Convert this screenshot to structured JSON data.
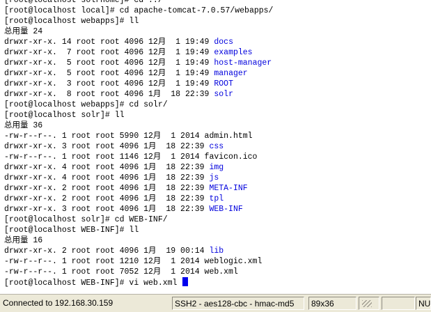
{
  "terminal": {
    "lines": [
      [
        {
          "t": "[root@localhost solrhome]# cd ../"
        }
      ],
      [
        {
          "t": "[root@localhost local]# cd apache-tomcat-7.0.57/webapps/"
        }
      ],
      [
        {
          "t": "[root@localhost webapps]# ll"
        }
      ],
      [
        {
          "t": "总用量 24"
        }
      ],
      [
        {
          "t": "drwxr-xr-x. 14 root root 4096 12月  1 19:49 "
        },
        {
          "t": "docs",
          "c": "dir"
        }
      ],
      [
        {
          "t": "drwxr-xr-x.  7 root root 4096 12月  1 19:49 "
        },
        {
          "t": "examples",
          "c": "dir"
        }
      ],
      [
        {
          "t": "drwxr-xr-x.  5 root root 4096 12月  1 19:49 "
        },
        {
          "t": "host-manager",
          "c": "dir"
        }
      ],
      [
        {
          "t": "drwxr-xr-x.  5 root root 4096 12月  1 19:49 "
        },
        {
          "t": "manager",
          "c": "dir"
        }
      ],
      [
        {
          "t": "drwxr-xr-x.  3 root root 4096 12月  1 19:49 "
        },
        {
          "t": "ROOT",
          "c": "dir"
        }
      ],
      [
        {
          "t": "drwxr-xr-x.  8 root root 4096 1月  18 22:39 "
        },
        {
          "t": "solr",
          "c": "dir"
        }
      ],
      [
        {
          "t": "[root@localhost webapps]# cd solr/"
        }
      ],
      [
        {
          "t": "[root@localhost solr]# ll"
        }
      ],
      [
        {
          "t": "总用量 36"
        }
      ],
      [
        {
          "t": "-rw-r--r--. 1 root root 5990 12月  1 2014 admin.html"
        }
      ],
      [
        {
          "t": "drwxr-xr-x. 3 root root 4096 1月  18 22:39 "
        },
        {
          "t": "css",
          "c": "dir"
        }
      ],
      [
        {
          "t": "-rw-r--r--. 1 root root 1146 12月  1 2014 favicon.ico"
        }
      ],
      [
        {
          "t": "drwxr-xr-x. 4 root root 4096 1月  18 22:39 "
        },
        {
          "t": "img",
          "c": "dir"
        }
      ],
      [
        {
          "t": "drwxr-xr-x. 4 root root 4096 1月  18 22:39 "
        },
        {
          "t": "js",
          "c": "dir"
        }
      ],
      [
        {
          "t": "drwxr-xr-x. 2 root root 4096 1月  18 22:39 "
        },
        {
          "t": "META-INF",
          "c": "dir"
        }
      ],
      [
        {
          "t": "drwxr-xr-x. 2 root root 4096 1月  18 22:39 "
        },
        {
          "t": "tpl",
          "c": "dir"
        }
      ],
      [
        {
          "t": "drwxr-xr-x. 3 root root 4096 1月  18 22:39 "
        },
        {
          "t": "WEB-INF",
          "c": "dir"
        }
      ],
      [
        {
          "t": "[root@localhost solr]# cd WEB-INF/"
        }
      ],
      [
        {
          "t": "[root@localhost WEB-INF]# ll"
        }
      ],
      [
        {
          "t": "总用量 16"
        }
      ],
      [
        {
          "t": "drwxr-xr-x. 2 root root 4096 1月  19 00:14 "
        },
        {
          "t": "lib",
          "c": "dir"
        }
      ],
      [
        {
          "t": "-rw-r--r--. 1 root root 1210 12月  1 2014 weblogic.xml"
        }
      ],
      [
        {
          "t": "-rw-r--r--. 1 root root 7052 12月  1 2014 web.xml"
        }
      ],
      [
        {
          "t": "[root@localhost WEB-INF]# vi web.xml "
        },
        {
          "t": "",
          "c": "cursor"
        }
      ]
    ]
  },
  "status_bar": {
    "connection": "Connected to 192.168.30.159",
    "encryption": "SSH2 - aes128-cbc - hmac-md5",
    "size": "89x36",
    "num_lock": "NU"
  },
  "colors": {
    "directory": "#0000dd",
    "cursor": "#0000ee",
    "status_bar_bg": "#ece9d8"
  }
}
